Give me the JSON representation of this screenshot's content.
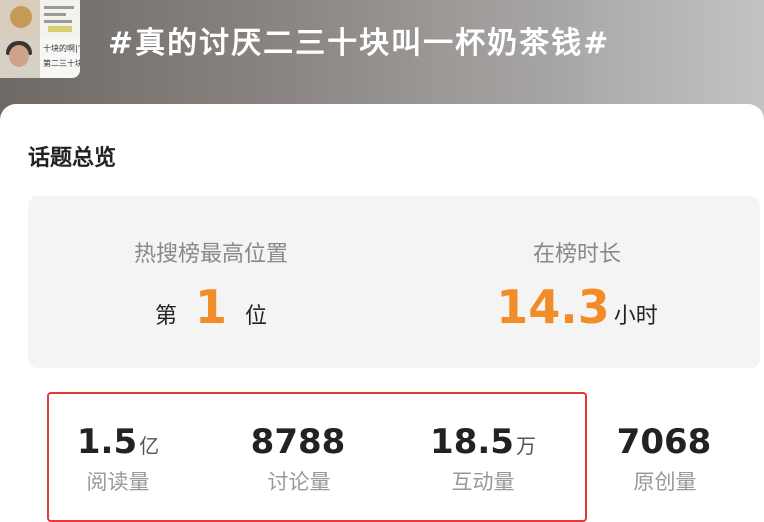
{
  "header": {
    "topic_title": "#真的讨厌二三十块叫一杯奶茶钱#",
    "thumbnail_text": [
      "十块的啊|“...",
      "第二三十块..."
    ]
  },
  "overview": {
    "title": "话题总览",
    "rank": {
      "label": "热搜榜最高位置",
      "prefix": "第",
      "value": "1",
      "suffix": "位"
    },
    "duration": {
      "label": "在榜时长",
      "value": "14.3",
      "unit": "小时"
    },
    "stats": [
      {
        "value": "1.5",
        "unit": "亿",
        "label": "阅读量"
      },
      {
        "value": "8788",
        "unit": "",
        "label": "讨论量"
      },
      {
        "value": "18.5",
        "unit": "万",
        "label": "互动量"
      },
      {
        "value": "7068",
        "unit": "",
        "label": "原创量"
      }
    ]
  },
  "colors": {
    "accent": "#f28c28",
    "highlight_border": "#e53935",
    "panel_bg": "#f4f4f4"
  }
}
